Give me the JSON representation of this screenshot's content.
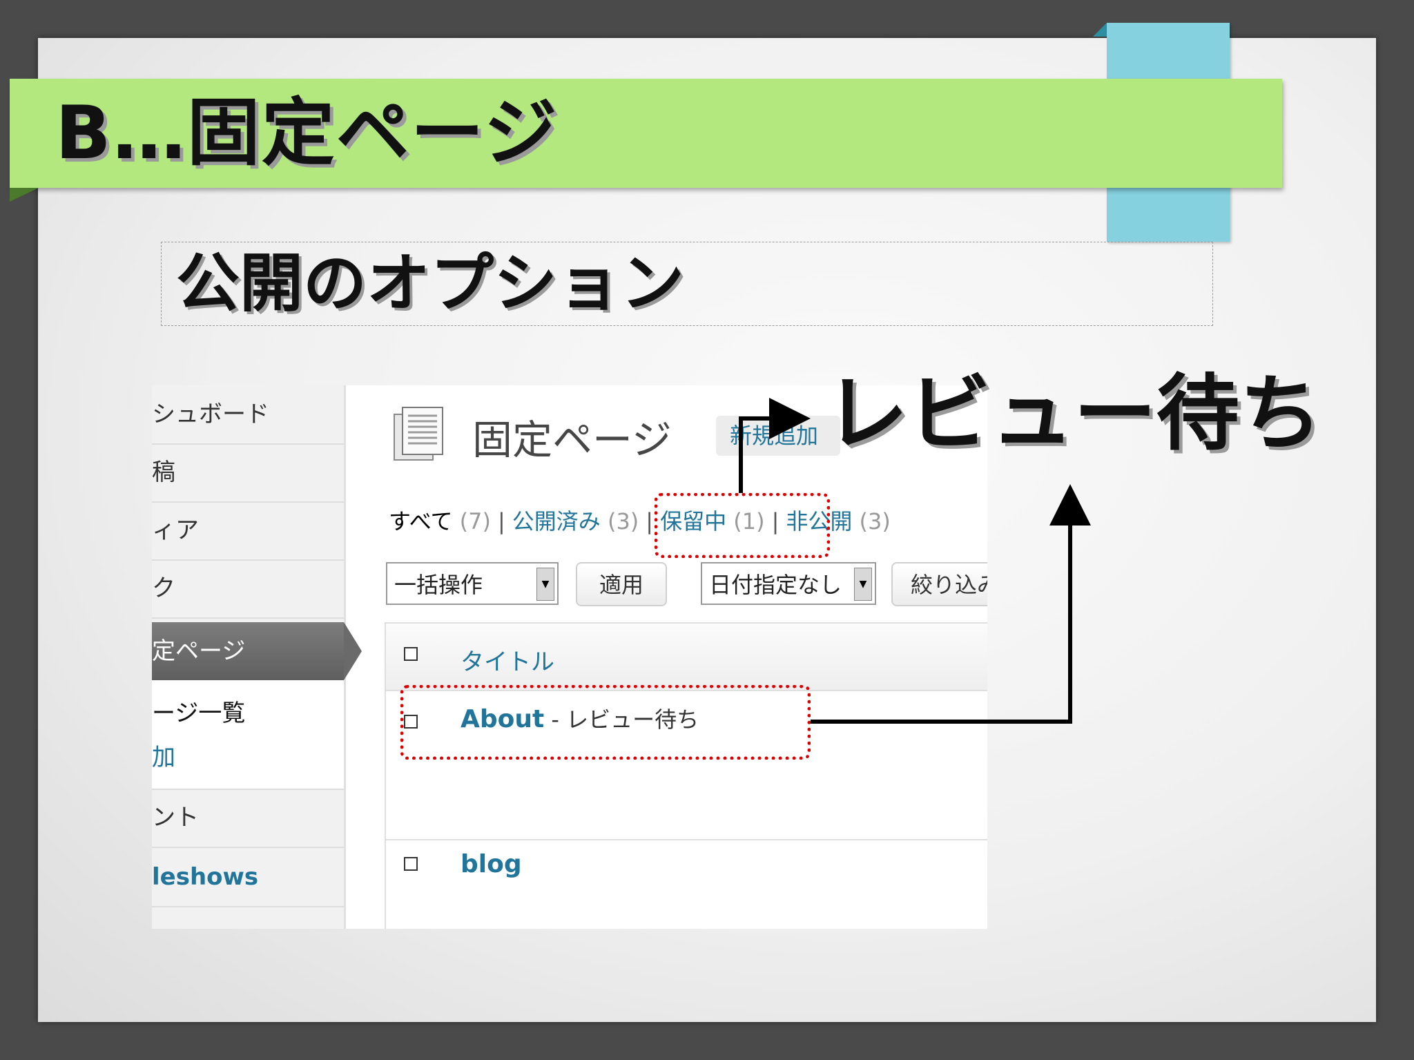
{
  "slide": {
    "title": "B…固定ページ",
    "subtitle": "公開のオプション",
    "callout": "レビュー待ち"
  },
  "wp_sidebar": {
    "items": [
      {
        "label": "シュボード"
      },
      {
        "label": "稿"
      },
      {
        "label": "ィア"
      },
      {
        "label": "ク"
      },
      {
        "label": "定ページ"
      },
      {
        "label": "ント"
      },
      {
        "label": "leshows"
      }
    ],
    "submenu": [
      {
        "label": "ージ一覧"
      },
      {
        "label": "加"
      }
    ]
  },
  "wp_main": {
    "page_title": "固定ページ",
    "add_new": "新規追加",
    "filters": {
      "all": "すべて",
      "all_count": "(7)",
      "published": "公開済み",
      "published_count": "(3)",
      "pending": "保留中",
      "pending_count": "(1)",
      "private": "非公開",
      "private_count": "(3)"
    },
    "bulk_action": "一括操作",
    "apply": "適用",
    "date_filter": "日付指定なし",
    "filter_button": "絞り込み",
    "table_header_title": "タイトル",
    "rows": [
      {
        "title": "About",
        "status": " - レビュー待ち"
      },
      {
        "title": "blog",
        "status": ""
      }
    ]
  },
  "colors": {
    "accent_green": "#b3e87f",
    "accent_cyan": "#86d1df",
    "wp_link": "#21759b",
    "highlight_red": "#dd0000"
  }
}
